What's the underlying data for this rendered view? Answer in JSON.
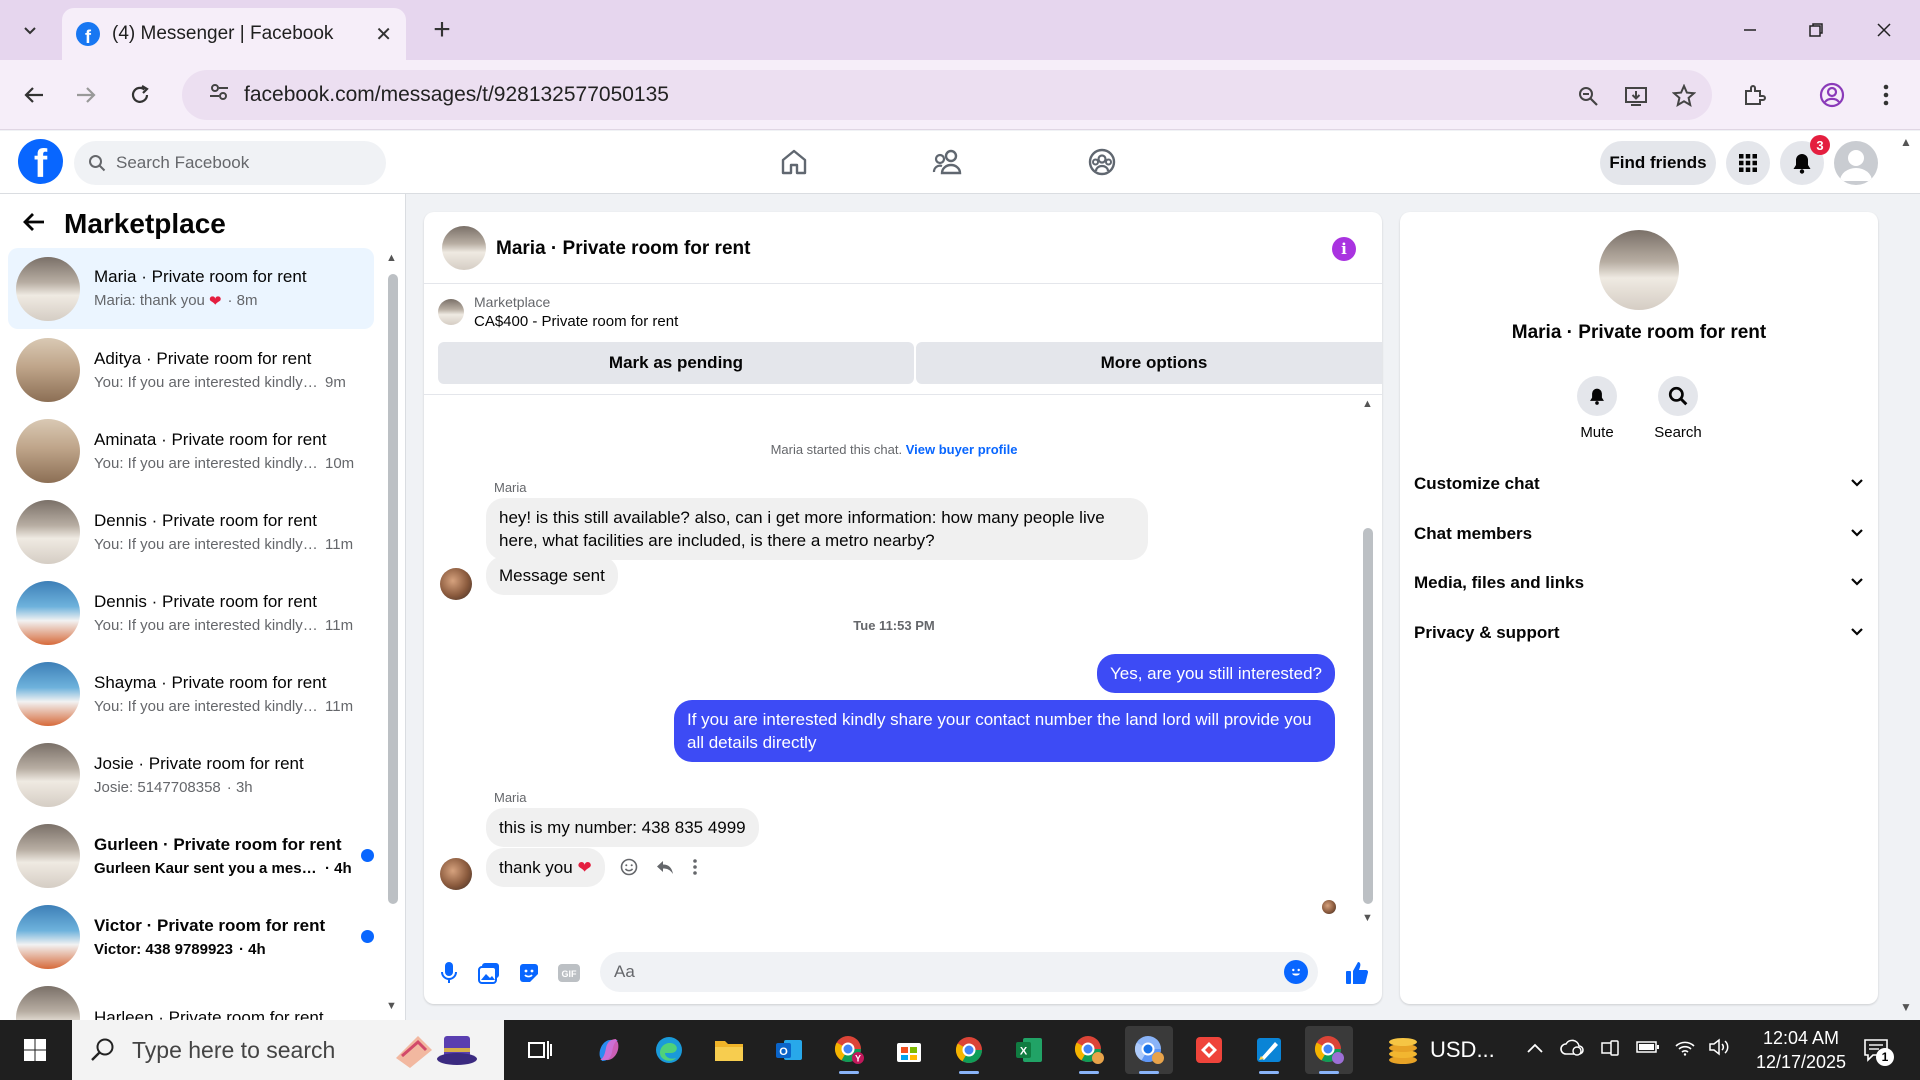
{
  "browser": {
    "tab_title": "(4) Messenger | Facebook",
    "url": "facebook.com/messages/t/928132577050135"
  },
  "fb_header": {
    "search_placeholder": "Search Facebook",
    "find_friends_label": "Find friends",
    "notification_count": "3"
  },
  "sidebar": {
    "title": "Marketplace",
    "conversations": [
      {
        "name": "Maria · Private room for rent",
        "preview": "Maria: thank you",
        "time": "· 8m",
        "heart": "❤",
        "thumb": "bed",
        "active": true,
        "unread": false
      },
      {
        "name": "Aditya · Private room for rent",
        "preview": "You: If you are interested kindly s...",
        "time": "9m",
        "thumb": "bath"
      },
      {
        "name": "Aminata · Private room for rent",
        "preview": "You: If you are interested kindly ...",
        "time": "10m",
        "thumb": "bath"
      },
      {
        "name": "Dennis · Private room for rent",
        "preview": "You: If you are interested kindly ...",
        "time": "11m",
        "thumb": "bed"
      },
      {
        "name": "Dennis · Private room for rent",
        "preview": "You: If you are interested kindly ...",
        "time": "11m",
        "thumb": "blue"
      },
      {
        "name": "Shayma · Private room for rent",
        "preview": "You: If you are interested kindly ...",
        "time": "11m",
        "thumb": "blue"
      },
      {
        "name": "Josie · Private room for rent",
        "preview": "Josie: 5147708358",
        "time": "· 3h",
        "thumb": "bed"
      },
      {
        "name": "Gurleen · Private room for rent",
        "preview": "Gurleen Kaur sent you a messa...",
        "time": "· 4h",
        "thumb": "bed",
        "unread": true
      },
      {
        "name": "Victor · Private room for rent",
        "preview": "Victor: 438 9789923",
        "time": "· 4h",
        "thumb": "blue",
        "unread": true
      },
      {
        "name": "Harleen · Private room for rent",
        "preview": "",
        "time": "",
        "thumb": "bed"
      }
    ]
  },
  "chat": {
    "title": "Maria · Private room for rent",
    "listing_label": "Marketplace",
    "listing_title": "CA$400 - Private room for rent",
    "mark_pending_label": "Mark as pending",
    "more_options_label": "More options",
    "started_text": "Maria started this chat.",
    "view_buyer_profile": "View buyer profile",
    "sender1": "Maria",
    "msg1": "hey! is this still available? also, can i get more information: how many people live here, what facilities are included, is there a metro nearby?",
    "msg2": "Message sent",
    "time_separator": "Tue 11:53 PM",
    "out1": "Yes, are you still interested?",
    "out2": "If you are interested kindly share your contact number the land lord will provide you all details directly",
    "sender2": "Maria",
    "msg3": "this is my number: 438 835 4999",
    "msg4": "thank you",
    "msg4_heart": "❤",
    "composer_placeholder": "Aa"
  },
  "info_panel": {
    "name": "Maria · Private room for rent",
    "mute_label": "Mute",
    "search_label": "Search",
    "sections": [
      "Customize chat",
      "Chat members",
      "Media, files and links",
      "Privacy & support"
    ]
  },
  "taskbar": {
    "search_placeholder": "Type here to search",
    "usd_label": "USD...",
    "time": "12:04 AM",
    "date": "12/17/2025",
    "notification_count": "1"
  },
  "colors": {
    "fb_blue": "#0866ff",
    "outgoing_bubble": "#3d4bf5",
    "info_purple": "#a933e0",
    "unread_dot": "#0866ff"
  }
}
